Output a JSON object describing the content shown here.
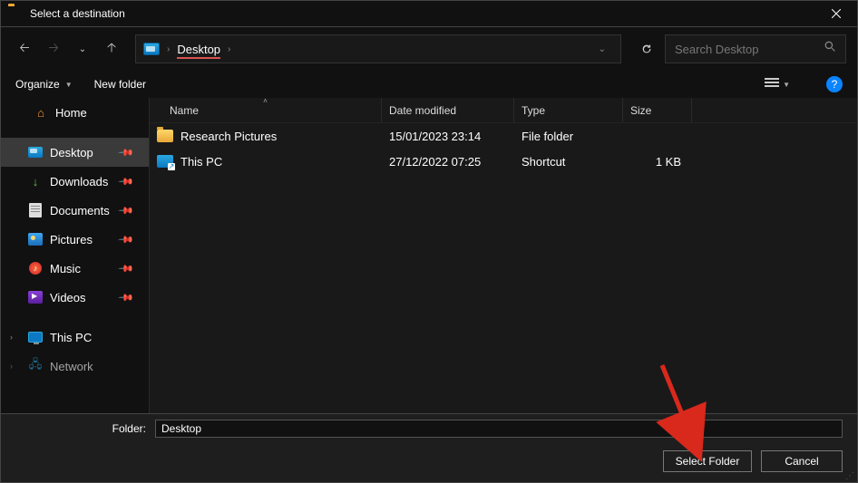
{
  "title": "Select a destination",
  "breadcrumb": {
    "location": "Desktop"
  },
  "search": {
    "placeholder": "Search Desktop"
  },
  "toolbar": {
    "organize": "Organize",
    "newfolder": "New folder"
  },
  "sidebar": {
    "home": "Home",
    "desktop": "Desktop",
    "downloads": "Downloads",
    "documents": "Documents",
    "pictures": "Pictures",
    "music": "Music",
    "videos": "Videos",
    "thispc": "This PC",
    "network": "Network"
  },
  "columns": {
    "name": "Name",
    "date": "Date modified",
    "type": "Type",
    "size": "Size"
  },
  "files": [
    {
      "name": "Research Pictures",
      "date": "15/01/2023 23:14",
      "type": "File folder",
      "size": "",
      "icon": "folder"
    },
    {
      "name": "This PC",
      "date": "27/12/2022 07:25",
      "type": "Shortcut",
      "size": "1 KB",
      "icon": "shortcut"
    }
  ],
  "footer": {
    "label": "Folder:",
    "value": "Desktop",
    "select": "Select Folder",
    "cancel": "Cancel"
  }
}
